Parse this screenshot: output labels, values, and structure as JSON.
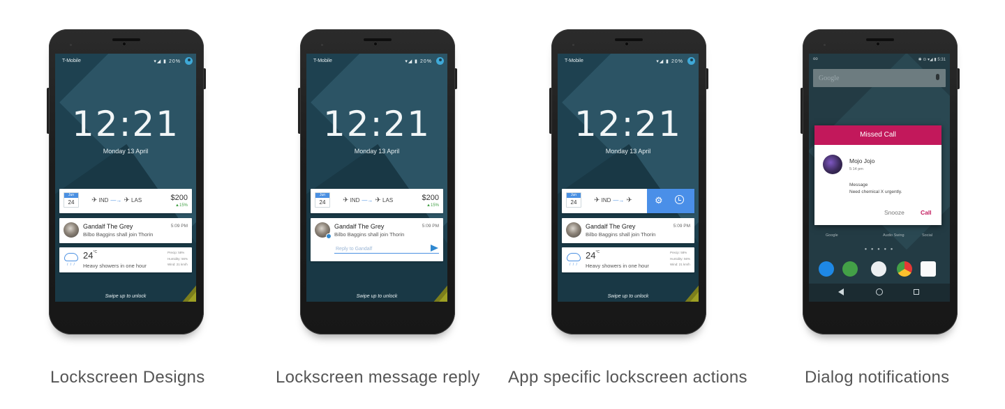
{
  "lockscreen": {
    "carrier": "T-Mobile",
    "battery": "20%",
    "time": "12:21",
    "date": "Monday 13 April",
    "swipe_hint": "Swipe up to unlock"
  },
  "flight_card": {
    "cal_month": "Jun",
    "cal_day": "24",
    "from": "IND",
    "to": "LAS",
    "price": "$200",
    "price_change": "▲15%"
  },
  "message_card": {
    "sender": "Gandalf The Grey",
    "text": "Bilbo Baggins shall join Thorin",
    "time": "5:09 PM",
    "reply_placeholder": "Reply to Gandalf"
  },
  "weather_card": {
    "temp": "24",
    "unit": "°C",
    "description": "Heavy showers in one hour",
    "precip": "Precip: 58%",
    "humidity": "Humidity: 56%",
    "wind": "Wind: 21 km/h"
  },
  "dialog": {
    "title": "Missed Call",
    "caller": "Mojo Jojo",
    "caller_time": "5:14 pm",
    "message_label": "Message",
    "message": "Need chemical X urgently.",
    "snooze": "Snooze",
    "call": "Call",
    "search_placeholder": "Google",
    "status_time": "5:31",
    "app_labels": [
      "Google",
      "Audio Swing",
      "Social"
    ]
  },
  "captions": [
    "Lockscreen Designs",
    "Lockscreen message reply",
    "App specific lockscreen actions",
    "Dialog notifications"
  ],
  "colors": {
    "lockscreen_bg": "#1e4150",
    "accent_blue": "#4a90e2",
    "dialog_header": "#c2185b",
    "action_panel": "#4a8fe8"
  }
}
